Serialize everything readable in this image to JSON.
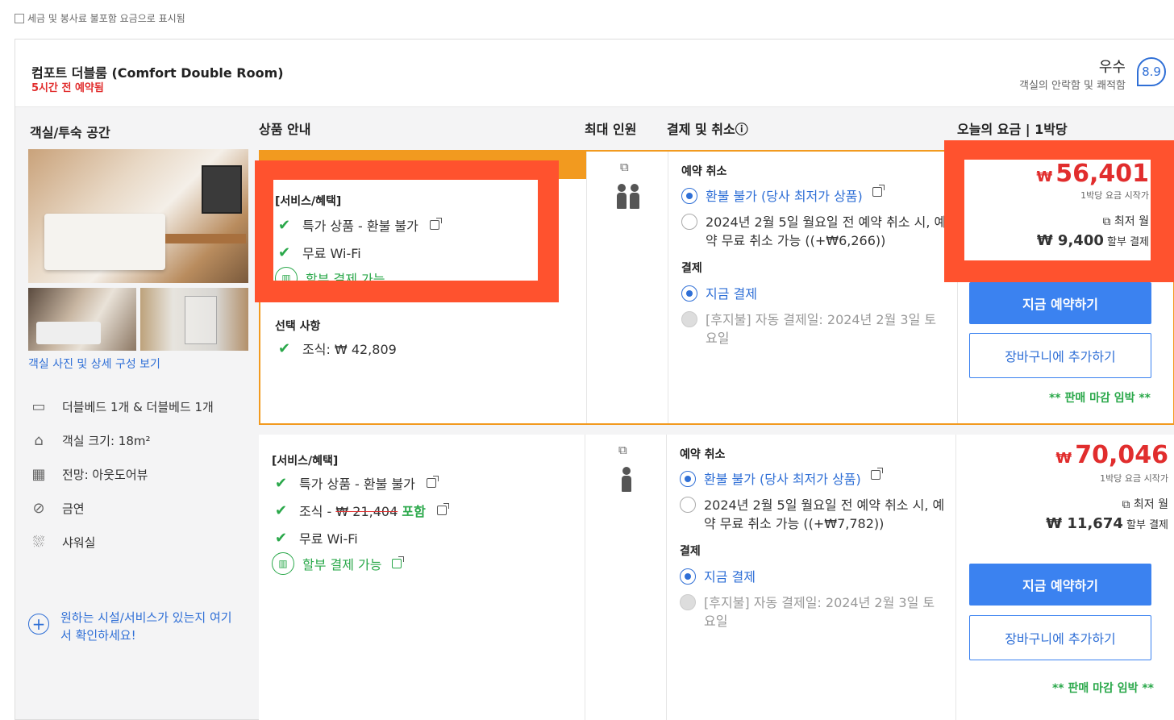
{
  "note": "세금 및 봉사료 불포함 요금으로 표시됨",
  "room": {
    "title": "컴포트 더블룸 (Comfort Double Room)",
    "booked": "5시간 전 예약됨",
    "rating_word": "우수",
    "rating_sub": "객실의 안락함 및 쾌적함",
    "rating_score": "8.9"
  },
  "columns": {
    "room": "객실/투숙 공간",
    "product": "상품 안내",
    "occupancy": "최대 인원",
    "payment": "결제 및 취소ⓘ",
    "price": "오늘의 요금 | 1박당"
  },
  "left": {
    "photo_link": "객실 사진 및 상세 구성 보기",
    "features": [
      {
        "icon": "bed-icon",
        "label": "더블베드 1개 & 더블베드 1개"
      },
      {
        "icon": "room-size-icon",
        "label": "객실 크기: 18m²"
      },
      {
        "icon": "view-icon",
        "label": "전망: 아웃도어뷰"
      },
      {
        "icon": "no-smoking-icon",
        "label": "금연"
      },
      {
        "icon": "shower-icon",
        "label": "샤워실"
      }
    ],
    "check_facility": "원하는 시설/서비스가 있는지 여기서 확인하세요!"
  },
  "offer1": {
    "benefits_title": "[서비스/혜택]",
    "benefit1": "특가 상품 - 환불 불가",
    "benefit2": "무료 Wi-Fi",
    "installment": "할부 결제 가능",
    "options_title": "선택 사항",
    "option1": "조식: ₩ 42,809",
    "cancel_title": "예약 취소",
    "cancel_opt1": "환불 불가 (당사 최저가 상품)",
    "cancel_opt2": "2024년 2월 5일 월요일 전 예약 취소 시, 예약 무료 취소 가능 ((+₩6,266))",
    "pay_title": "결제",
    "pay_opt1": "지금 결제",
    "pay_opt2": "[후지불] 자동 결제일: 2024년 2월 3일 토요일",
    "currency": "₩",
    "price": "56,401",
    "price_sub": "1박당 요금 시작가",
    "monthly": "최저 월",
    "installment_amount": "₩ 9,400",
    "installment_label": "할부 결제",
    "book_btn": "지금 예약하기",
    "cart_btn": "장바구니에 추가하기",
    "soon": "** 판매 마감 임박 **"
  },
  "offer2": {
    "benefits_title": "[서비스/혜택]",
    "benefit1": "특가 상품 - 환불 불가",
    "benefit2_prefix": "조식 - ",
    "benefit2_strike": "₩ 21,404",
    "benefit2_included": "포함",
    "benefit3": "무료 Wi-Fi",
    "installment": "할부 결제 가능",
    "cancel_title": "예약 취소",
    "cancel_opt1": "환불 불가 (당사 최저가 상품)",
    "cancel_opt2": "2024년 2월 5일 월요일 전 예약 취소 시, 예약 무료 취소 가능 ((+₩7,782))",
    "pay_title": "결제",
    "pay_opt1": "지금 결제",
    "pay_opt2": "[후지불] 자동 결제일: 2024년 2월 3일 토요일",
    "currency": "₩",
    "price": "70,046",
    "price_sub": "1박당 요금 시작가",
    "monthly": "최저 월",
    "installment_amount": "₩ 11,674",
    "installment_label": "할부 결제",
    "book_btn": "지금 예약하기",
    "cart_btn": "장바구니에 추가하기",
    "soon": "** 판매 마감 임박 **"
  },
  "colors": {
    "accent": "#3b82f0",
    "highlight": "#ff522e",
    "sale_orange": "#f29a1f",
    "price_red": "#e12d2d",
    "green": "#2aa84a"
  }
}
